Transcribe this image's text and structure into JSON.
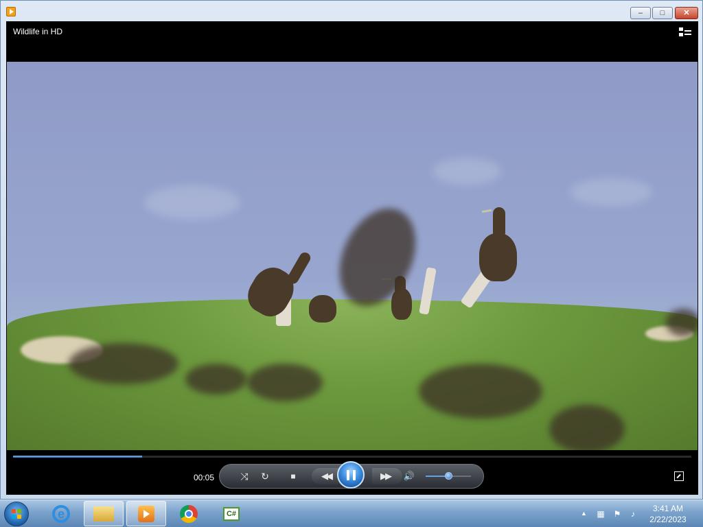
{
  "window": {
    "minimize_glyph": "–",
    "maximize_glyph": "□",
    "close_glyph": "✕"
  },
  "player": {
    "title": "Wildlife in HD",
    "elapsed_time": "00:05",
    "progress_fraction": 0.19,
    "volume_fraction": 0.5,
    "icons": {
      "switch_view": "switch-to-library-icon",
      "shuffle": "shuffle-icon",
      "repeat": "repeat-icon",
      "stop": "stop-icon",
      "previous": "rewind-icon",
      "play_pause": "pause-icon",
      "next": "fast-forward-icon",
      "mute": "speaker-icon",
      "fullscreen": "fullscreen-icon"
    },
    "glyphs": {
      "shuffle": "⤨",
      "repeat": "↻",
      "stop": "■",
      "previous": "◀◀",
      "next": "▶▶",
      "mute": "🔊"
    }
  },
  "taskbar": {
    "pinned": [
      "start-button",
      "internet-explorer",
      "windows-explorer",
      "windows-media-player",
      "google-chrome",
      "csharp-app"
    ],
    "active_app": "windows-media-player",
    "tray_arrow": "▲",
    "tray_icons": [
      "network-icon",
      "action-center-icon",
      "volume-icon"
    ],
    "clock_time": "3:41 AM",
    "clock_date": "2/22/2023"
  },
  "colors": {
    "accent": "#3d8ee0",
    "taskbar": "#7aa2cb",
    "close_button": "#c7452c"
  }
}
